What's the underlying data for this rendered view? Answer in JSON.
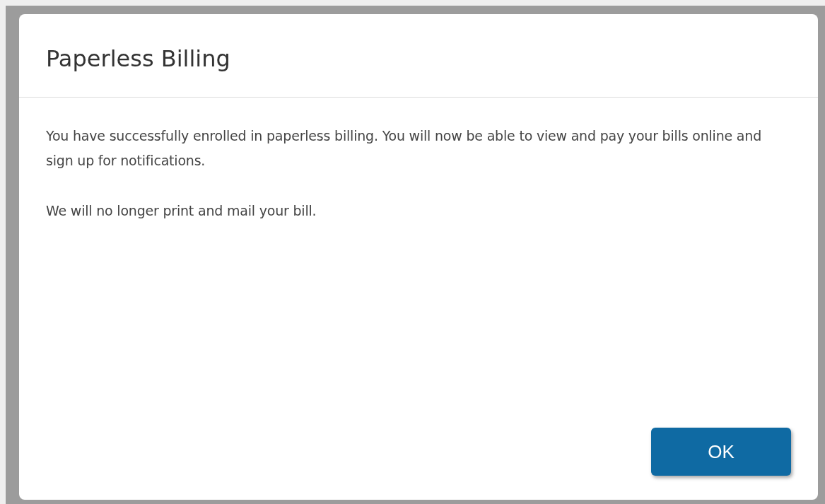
{
  "dialog": {
    "title": "Paperless Billing",
    "paragraphs": [
      "You have successfully enrolled in paperless billing. You will now be able to view and pay your bills online and sign up for notifications.",
      "We will no longer print and mail your bill."
    ],
    "buttons": [
      "OK"
    ]
  }
}
